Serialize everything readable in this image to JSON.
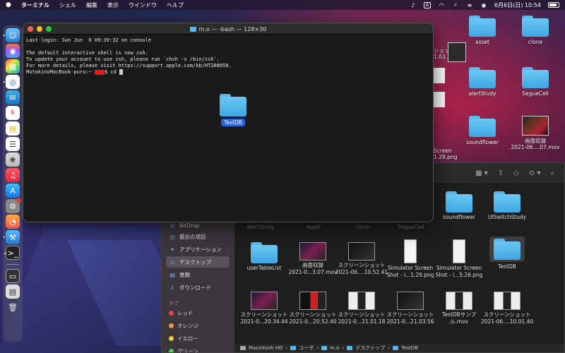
{
  "menubar": {
    "app_name": "ターミナル",
    "items": [
      "シェル",
      "編集",
      "表示",
      "ウインドウ",
      "ヘルプ"
    ],
    "input_indicator": "A",
    "date_time": "6月6日(日)  10:54"
  },
  "terminal": {
    "title": "m.o — -bash — 128×30",
    "lines": {
      "l1": "Last login: Sun Jun  6 09:39:32 on console",
      "l2": "",
      "l3": "The default interactive shell is now zsh.",
      "l4": "To update your account to use zsh, please run `chsh -s /bin/zsh`.",
      "l5": "For more details, please visit https://support.apple.com/kb/HT208050.",
      "prompt_prefix": "MotokinoMacBook-puro:~ ",
      "prompt_suffix": "$ cd "
    },
    "dragged_item": "TestDB"
  },
  "desktop": {
    "icons": [
      {
        "label": "asset"
      },
      {
        "label": "clone"
      },
      {
        "label": "alertStudy"
      },
      {
        "label": "SegueCell"
      },
      {
        "label": "soundflower"
      },
      {
        "label": "画面収録\n2021-06....07.mov"
      }
    ],
    "partial_labels": {
      "top": "ショット\n1.03.56",
      "mid": "Screen\n1.29.png"
    }
  },
  "finder": {
    "sidebar": {
      "favorites_partial": "AirDrop",
      "items": [
        {
          "label": "最近の項目",
          "icon": "clock-icon"
        },
        {
          "label": "アプリケーション",
          "icon": "apps-icon"
        },
        {
          "label": "デスクトップ",
          "icon": "desktop-icon"
        },
        {
          "label": "書類",
          "icon": "document-icon"
        },
        {
          "label": "ダウンロード",
          "icon": "download-icon"
        }
      ],
      "tags_heading": "タグ",
      "tags": [
        {
          "label": "レッド",
          "color": "#e5453d"
        },
        {
          "label": "オレンジ",
          "color": "#f09a37"
        },
        {
          "label": "イエロー",
          "color": "#f5cf3b"
        },
        {
          "label": "グリーン",
          "color": "#5ac25d"
        }
      ]
    },
    "faded_row": [
      "alertStudy",
      "asset",
      "clone",
      "SegueCell"
    ],
    "row1": [
      {
        "label": "soundflower"
      },
      {
        "label": "UISwitchStudy"
      }
    ],
    "row2": [
      {
        "label": "userTableList"
      },
      {
        "label": "画面収録\n2021-0...3.07.mov"
      },
      {
        "label": "スクリーンショット\n2021-06....10.52.41"
      },
      {
        "label": "Simulator Screen\nShot - i...1.29.png"
      },
      {
        "label": "Simulator Screen\nShot - i...5.26.png"
      },
      {
        "label": "TestDB"
      }
    ],
    "row3": [
      {
        "label": "スクリーンショット\n2021-0...20.34.44"
      },
      {
        "label": "スクリーンショット\n2021-0...20.52.40"
      },
      {
        "label": "スクリーンショット\n2021-0...21.01.18"
      },
      {
        "label": "スクリーンショット\n2021-0...21.03.56"
      },
      {
        "label": "TestDBサンプ\nル.mov"
      },
      {
        "label": "スクリーンショット\n2021-06....10.01.40"
      }
    ],
    "pathbar": [
      "Macintosh HD",
      "ユーザ",
      "m.o",
      "デスクトップ",
      "TestDB"
    ]
  }
}
